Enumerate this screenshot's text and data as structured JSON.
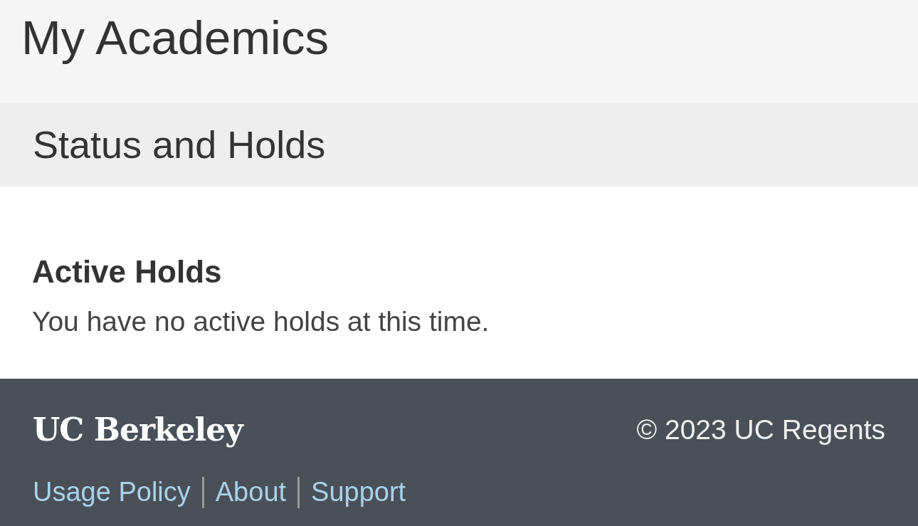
{
  "page": {
    "title": "My Academics"
  },
  "section": {
    "title": "Status and Holds"
  },
  "holds": {
    "heading": "Active Holds",
    "message": "You have no active holds at this time."
  },
  "footer": {
    "logo": "UC Berkeley",
    "copyright": "© 2023 UC Regents",
    "links": [
      "Usage Policy",
      "About",
      "Support"
    ]
  }
}
